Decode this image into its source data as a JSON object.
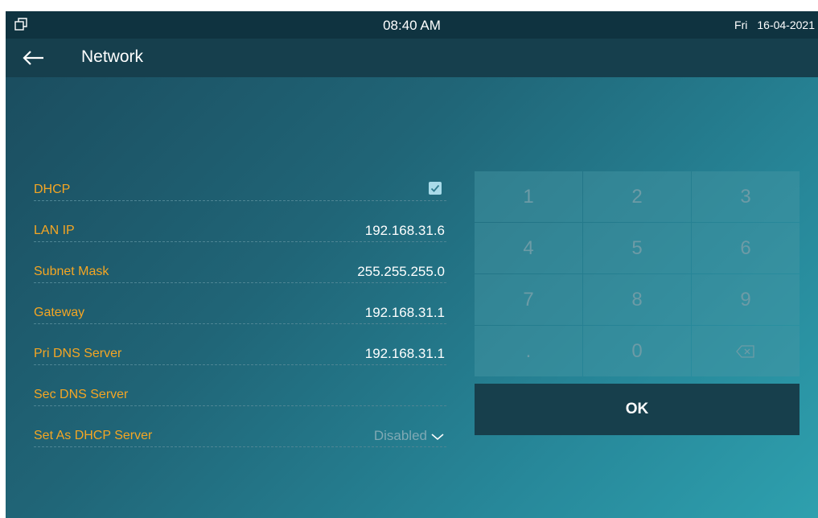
{
  "status": {
    "time": "08:40 AM",
    "day": "Fri",
    "date": "16-04-2021",
    "window_icon": "window-restore-icon"
  },
  "header": {
    "title": "Network",
    "back_icon": "back-arrow-icon"
  },
  "settings": {
    "dhcp": {
      "label": "DHCP",
      "checked": true
    },
    "lan_ip": {
      "label": "LAN IP",
      "value": "192.168.31.6"
    },
    "subnet_mask": {
      "label": "Subnet Mask",
      "value": "255.255.255.0"
    },
    "gateway": {
      "label": "Gateway",
      "value": "192.168.31.1"
    },
    "pri_dns": {
      "label": "Pri DNS Server",
      "value": "192.168.31.1"
    },
    "sec_dns": {
      "label": "Sec DNS Server",
      "value": ""
    },
    "dhcp_server": {
      "label": "Set As DHCP Server",
      "value": "Disabled"
    }
  },
  "keypad": {
    "keys": [
      "1",
      "2",
      "3",
      "4",
      "5",
      "6",
      "7",
      "8",
      "9",
      ".",
      "0"
    ],
    "backspace_icon": "backspace-icon",
    "ok_label": "OK"
  },
  "colors": {
    "label": "#f5a623",
    "value": "#ffffff",
    "status_bar": "#0f3340",
    "title_bar": "#163f4d",
    "ok_button": "#173f4c"
  }
}
